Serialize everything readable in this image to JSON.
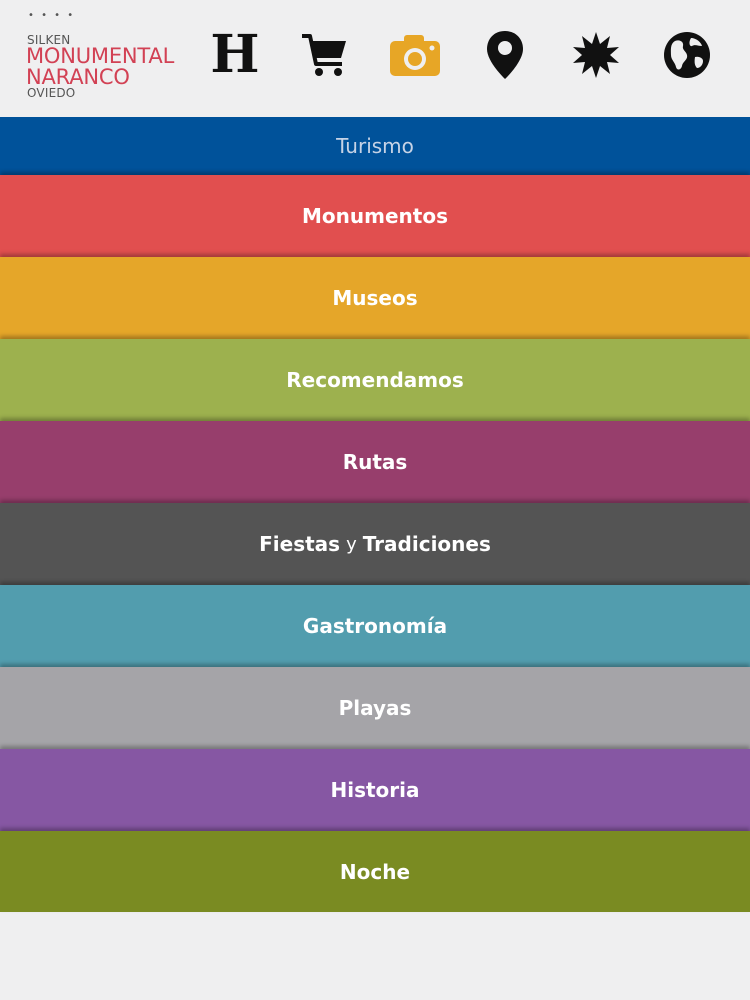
{
  "logo": {
    "dots": "• • • •",
    "top_line": "SILKEN",
    "line1": "MONUMENTAL",
    "line2": "NARANCO",
    "bottom_line": "OVIEDO"
  },
  "toolbar": {
    "hotel_letter": "H",
    "icons": [
      "hotel-icon",
      "cart-icon",
      "camera-icon",
      "location-pin-icon",
      "star-burst-icon",
      "globe-icon"
    ],
    "active_color": "#e7a626"
  },
  "menu": {
    "title": "Turismo",
    "title_color": "#00529a",
    "items": [
      {
        "label": "Monumentos",
        "color": "#e14f4f"
      },
      {
        "label": "Museos",
        "color": "#e5a629"
      },
      {
        "label": "Recomendamos",
        "color": "#9db14e"
      },
      {
        "label": "Rutas",
        "color": "#973e6c"
      },
      {
        "label_a": "Fiestas",
        "label_amp": "y",
        "label_b": "Tradiciones",
        "color": "#545454"
      },
      {
        "label": "Gastronomía",
        "color": "#529dae"
      },
      {
        "label": "Playas",
        "color": "#a5a4a8"
      },
      {
        "label": "Historia",
        "color": "#8657a3"
      },
      {
        "label": "Noche",
        "color": "#7a8b22"
      }
    ]
  }
}
